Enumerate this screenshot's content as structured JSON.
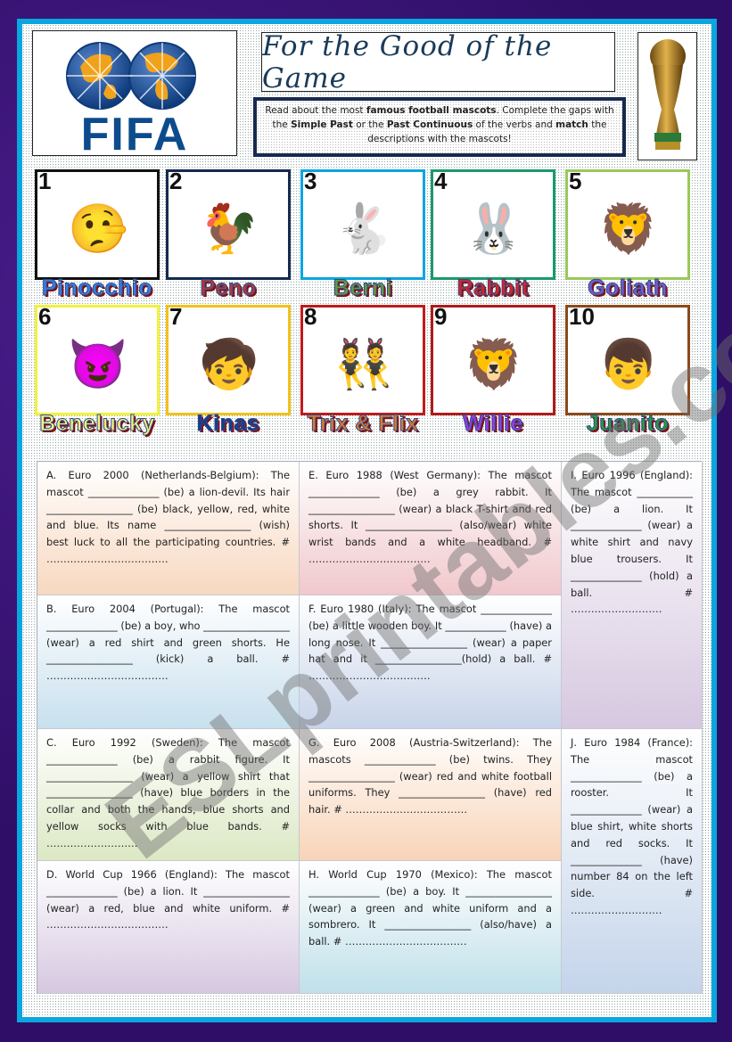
{
  "header": {
    "logo_text": "FIFA",
    "title": "For the Good of the Game",
    "instructions": {
      "part1": "Read about the most ",
      "bold1": "famous football mascots",
      "part2": ". Complete the gaps with the ",
      "bold2": "Simple Past",
      "part3": " or the ",
      "bold3": "Past Continuous",
      "part4": " of the verbs and ",
      "bold4": "match",
      "part5": " the descriptions with the mascots!"
    }
  },
  "mascots": [
    {
      "number": "1",
      "name": "Pinocchio",
      "icon": "wooden-boy-icon",
      "glyph": "🤥",
      "border": "#111111",
      "label_color": "#3a7de0"
    },
    {
      "number": "2",
      "name": "Peno",
      "icon": "rooster-icon",
      "glyph": "🐓",
      "border": "#162a4e",
      "label_color": "#b03a3a"
    },
    {
      "number": "3",
      "name": "Berni",
      "icon": "rabbit-icon",
      "glyph": "🐇",
      "border": "#0aa6df",
      "label_color": "#6a9a3a"
    },
    {
      "number": "4",
      "name": "Rabbit",
      "icon": "rabbit-icon",
      "glyph": "🐰",
      "border": "#1a9a6a",
      "label_color": "#e02020"
    },
    {
      "number": "5",
      "name": "Goliath",
      "icon": "lion-icon",
      "glyph": "🦁",
      "border": "#9ac85a",
      "label_color": "#7a5ac8"
    },
    {
      "number": "6",
      "name": "Benelucky",
      "icon": "lion-devil-icon",
      "glyph": "😈",
      "border": "#f2f23a",
      "label_color": "#f2f27a"
    },
    {
      "number": "7",
      "name": "Kinas",
      "icon": "boy-icon",
      "glyph": "🧒",
      "border": "#f2c21a",
      "label_color": "#1a3a8a"
    },
    {
      "number": "8",
      "name": "Trix & Flix",
      "icon": "twins-icon",
      "glyph": "👯",
      "border": "#c21a1a",
      "label_color": "#e07a2a"
    },
    {
      "number": "9",
      "name": "Willie",
      "icon": "lion-icon",
      "glyph": "🦁",
      "border": "#b01a1a",
      "label_color": "#9a3ae0"
    },
    {
      "number": "10",
      "name": "Juanito",
      "icon": "sombrero-boy-icon",
      "glyph": "👦",
      "border": "#8a4a1a",
      "label_color": "#2a9a3a"
    }
  ],
  "exercises": [
    {
      "id": "A",
      "text": "A. Euro 2000 (Netherlands-Belgium): The mascot ______________ (be) a lion-devil. Its hair _________________ (be) black, yellow, red, white and blue. Its name _________________ (wish) best luck to all the participating countries. # ………………………………"
    },
    {
      "id": "E",
      "text": "E. Euro 1988 (West Germany): The mascot ______________ (be) a grey rabbit. It _________________ (wear) a black T-shirt and red shorts. It _________________ (also/wear) white wrist bands and a white headband. # ………………………………"
    },
    {
      "id": "I",
      "text": "I. Euro 1996 (England): The mascot ___________ (be) a lion. It ______________ (wear) a white shirt and navy blue trousers. It ______________ (hold) a ball. # ………………………"
    },
    {
      "id": "B",
      "text": "B. Euro 2004 (Portugal): The mascot ______________ (be) a boy, who _________________ (wear) a red shirt and green shorts. He _________________ (kick) a ball. # ………………………………"
    },
    {
      "id": "F",
      "text": "F. Euro 1980 (Italy): The mascot ______________ (be) a little wooden boy. It ____________ (have) a long nose. It _________________ (wear) a paper hat and it _________________(hold) a ball. # ………………………………"
    },
    {
      "id": "C",
      "text": "C. Euro 1992 (Sweden): The mascot ______________ (be) a rabbit figure. It _________________ (wear) a yellow shirt that _________________ (have) blue borders in the collar and both the hands, blue shorts and yellow socks with blue bands. # ………………………"
    },
    {
      "id": "G",
      "text": "G. Euro 2008 (Austria-Switzerland): The mascots ______________ (be) twins. They _________________ (wear) red and white football uniforms. They _________________ (have) red hair. # ………………………………"
    },
    {
      "id": "J",
      "text": "J. Euro 1984 (France): The mascot ______________ (be) a rooster. It ______________ (wear) a blue shirt, white shorts and red socks. It ______________ (have) number 84 on the left side. # ………………………"
    },
    {
      "id": "D",
      "text": "D. World Cup 1966 (England): The mascot ______________ (be) a lion. It _________________ (wear) a red, blue and white uniform. # ………………………………"
    },
    {
      "id": "H",
      "text": "H. World Cup 1970 (Mexico): The mascot ______________ (be) a boy. It _________________ (wear) a green and white uniform and a sombrero. It _________________ (also/have) a ball. # ………………………………"
    }
  ],
  "watermark": "ESLprintables.com",
  "colors": {
    "page_bg": "#3a1478",
    "frame": "#0aa6df",
    "fifa_blue": "#0d4c8c",
    "instr_border": "#162a4e"
  }
}
